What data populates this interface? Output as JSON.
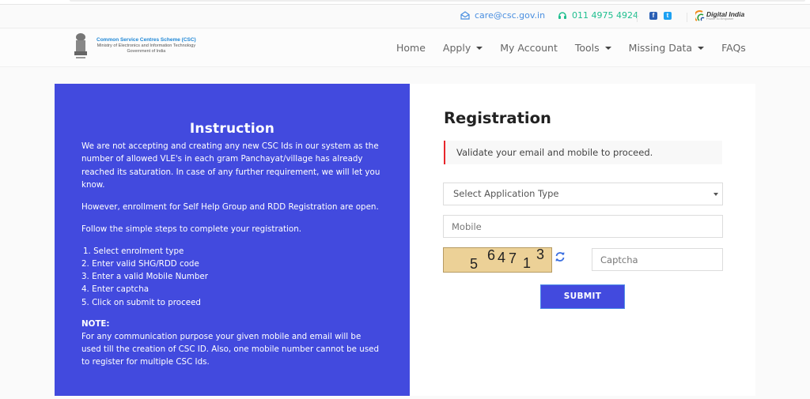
{
  "topbar": {
    "email": "care@csc.gov.in",
    "phone": "011 4975 4924",
    "social": [
      {
        "icon": "facebook-icon",
        "glyph": "f"
      },
      {
        "icon": "twitter-icon",
        "glyph": "t"
      }
    ],
    "digital_india": {
      "title": "Digital India",
      "tagline": "Power To Empower"
    }
  },
  "brand": {
    "title": "Common Service Centres Scheme (CSC)",
    "subtitle": "Ministry of Electronics and Information Technology",
    "gov": "Government of India"
  },
  "nav": {
    "items": [
      {
        "label": "Home",
        "dropdown": false
      },
      {
        "label": "Apply",
        "dropdown": true
      },
      {
        "label": "My Account",
        "dropdown": false
      },
      {
        "label": "Tools",
        "dropdown": true
      },
      {
        "label": "Missing Data",
        "dropdown": true
      },
      {
        "label": "FAQs",
        "dropdown": false
      }
    ]
  },
  "instruction": {
    "title": "Instruction",
    "para1": "We are not accepting and creating any new CSC Ids in our system as the number of allowed VLE's in each gram Panchayat/village has already reached its saturation. In case of any further requirement, we will let you know.",
    "para2": "However, enrollment for Self Help Group and RDD Registration are open.",
    "para3": "Follow the simple steps to complete your registration.",
    "steps": [
      " 1. Select enrolment type",
      "2. Enter valid SHG/RDD code",
      "3. Enter a valid Mobile Number",
      "4. Enter captcha",
      "5. Click on submit to proceed"
    ],
    "note_heading": "NOTE:",
    "note": "For any communication purpose your given mobile and email will be used till the creation of CSC ID. Also, one mobile number cannot be used to register for multiple CSC Ids."
  },
  "registration": {
    "title": "Registration",
    "alert": "Validate your email and mobile to proceed.",
    "application_type": {
      "selected": "Select Application Type"
    },
    "mobile": {
      "value": "",
      "placeholder": "Mobile"
    },
    "captcha_digits": [
      "5",
      "6",
      "4",
      "7",
      "1",
      "3"
    ],
    "captcha": {
      "value": "",
      "placeholder": "Captcha"
    },
    "submit_label": "SUBMIT"
  },
  "colors": {
    "primary": "#424ade",
    "alert_border": "#e8262c",
    "email": "#4a8fe0",
    "phone": "#1fbf8f",
    "brand_title": "#1d86d6",
    "captcha_bg": "#ecd197"
  }
}
